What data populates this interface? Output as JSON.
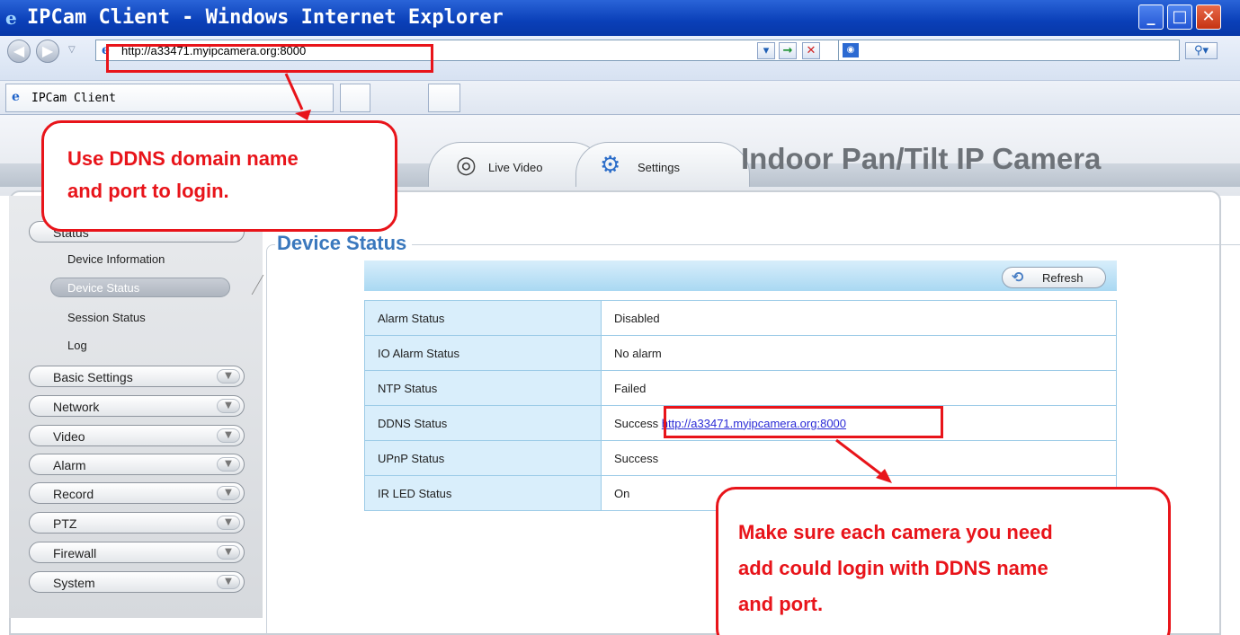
{
  "window": {
    "title": "IPCam Client - Windows Internet Explorer"
  },
  "addressbar": {
    "url": "http://a33471.myipcamera.org:8000"
  },
  "tabs": [
    {
      "label": "IPCam Client"
    }
  ],
  "app": {
    "product_name": "Indoor Pan/Tilt IP Camera",
    "nav": {
      "live_video": "Live Video",
      "settings": "Settings"
    }
  },
  "sidebar": {
    "status_header": "Status",
    "status_subitems": [
      "Device Information",
      "Device Status",
      "Session Status",
      "Log"
    ],
    "sections": [
      "Basic Settings",
      "Network",
      "Video",
      "Alarm",
      "Record",
      "PTZ",
      "Firewall",
      "System"
    ]
  },
  "content": {
    "title": "Device Status",
    "refresh_label": "Refresh",
    "rows": [
      {
        "label": "Alarm Status",
        "value": "Disabled"
      },
      {
        "label": "IO Alarm Status",
        "value": "No alarm"
      },
      {
        "label": "NTP Status",
        "value": "Failed"
      },
      {
        "label": "DDNS Status",
        "value": "Success",
        "link": "http://a33471.myipcamera.org:8000"
      },
      {
        "label": "UPnP Status",
        "value": "Success"
      },
      {
        "label": "IR LED Status",
        "value": "On"
      }
    ]
  },
  "callouts": {
    "login": [
      "Use DDNS domain name",
      "and port to login."
    ],
    "ddns": [
      "Make sure each camera you need",
      "add could login with DDNS name",
      "and port."
    ]
  },
  "colors": {
    "annotation": "#e8141a",
    "title_blue": "#3a78bd",
    "titlebar": "#0a3fb8"
  }
}
